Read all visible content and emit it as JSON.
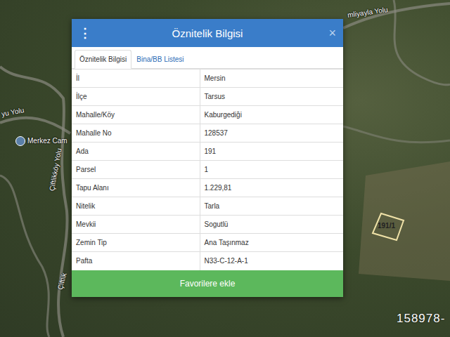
{
  "map": {
    "labels": [
      {
        "text": "yu Yolu"
      },
      {
        "text": "Merkez Cam"
      },
      {
        "text": "Çiftlikköy Yolu"
      },
      {
        "text": "Çiftlik"
      },
      {
        "text": "mliyayla Yolu"
      }
    ],
    "parcel_label": "191/1",
    "watermark": "158978-"
  },
  "dialog": {
    "menu_icon": "⋮",
    "title": "Öznitelik Bilgisi",
    "close": "×",
    "tabs": [
      {
        "label": "Öznitelik Bilgisi",
        "selected": true
      },
      {
        "label": "Bina/BB Listesi",
        "selected": false
      }
    ],
    "rows": [
      [
        "İl",
        "Mersin"
      ],
      [
        "İlçe",
        "Tarsus"
      ],
      [
        "Mahalle/Köy",
        "Kaburgediği"
      ],
      [
        "Mahalle No",
        "128537"
      ],
      [
        "Ada",
        "191"
      ],
      [
        "Parsel",
        "1"
      ],
      [
        "Tapu Alanı",
        "1.229,81"
      ],
      [
        "Nitelik",
        "Tarla"
      ],
      [
        "Mevkii",
        "Sogutlü"
      ],
      [
        "Zemin Tip",
        "Ana Taşınmaz"
      ],
      [
        "Pafta",
        "N33-C-12-A-1"
      ]
    ],
    "button": "Favorilere ekle"
  }
}
